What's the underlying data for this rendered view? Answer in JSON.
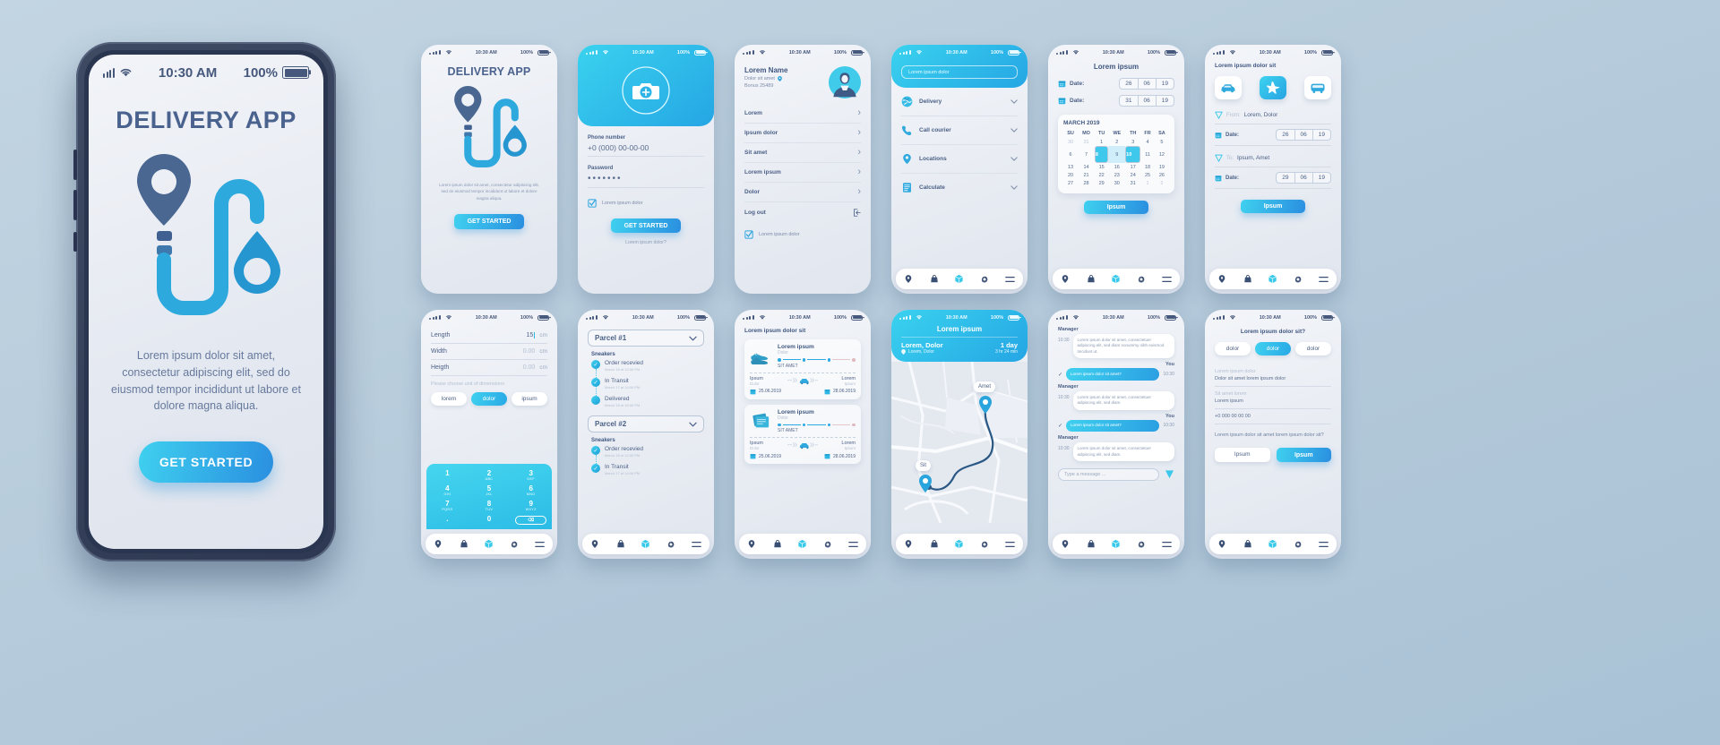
{
  "meta": {
    "status_time": "10:30 AM",
    "battery": "100%",
    "accent_cyan": "#3fd0ef",
    "accent_blue": "#2a8fe0",
    "navy": "#4a628e"
  },
  "main_phone": {
    "title": "DELIVERY APP",
    "description": "Lorem ipsum dolor sit amet, consectetur adipiscing elit, sed do eiusmod tempor incididunt ut labore et dolore magna aliqua.",
    "cta": "GET STARTED"
  },
  "screens": {
    "splash": {
      "title": "DELIVERY APP",
      "description": "Lorem ipsum dolor sit amet, consectetur adipiscing elit, sed do eiusmod tempor incididunt ut labore et dolore magna aliqua.",
      "cta": "GET STARTED"
    },
    "login": {
      "phone_label": "Phone number",
      "phone_value": "+0 (000) 00-00-00",
      "password_label": "Password",
      "password_value": "•••••••",
      "checkbox_label": "Lorem ipsum dolor",
      "cta": "GET STARTED",
      "footer_link": "Lorem ipsum dolor?"
    },
    "profile": {
      "name": "Lorem Name",
      "location": "Dolor sit amet",
      "bonus": "Bonus 25489",
      "items": [
        "Lorem",
        "Ipsum dolor",
        "Sit amet",
        "Lorem ipsum",
        "Dolor"
      ],
      "logout": "Log out",
      "checkbox_label": "Lorem ipsum dolor"
    },
    "menu": {
      "search_placeholder": "Lorem ipsum dolor",
      "items": [
        {
          "label": "Delivery",
          "icon": "globe-icon"
        },
        {
          "label": "Call courier",
          "icon": "phone-icon"
        },
        {
          "label": "Locations",
          "icon": "pin-icon"
        },
        {
          "label": "Calculate",
          "icon": "document-icon"
        }
      ]
    },
    "calendar": {
      "title": "Lorem ipsum",
      "date_label": "Date:",
      "date_from": [
        "26",
        "06",
        "19"
      ],
      "date_to": [
        "31",
        "06",
        "19"
      ],
      "month": "MARCH 2019",
      "weekdays": [
        "SU",
        "MO",
        "TU",
        "WE",
        "TH",
        "FR",
        "SA"
      ],
      "weeks": [
        [
          {
            "d": "30",
            "t": "out"
          },
          {
            "d": "31",
            "t": "out"
          },
          {
            "d": "1"
          },
          {
            "d": "2"
          },
          {
            "d": "3"
          },
          {
            "d": "4"
          },
          {
            "d": "5"
          }
        ],
        [
          {
            "d": "6"
          },
          {
            "d": "7"
          },
          {
            "d": "8",
            "t": "sel"
          },
          {
            "d": "9",
            "t": "rng"
          },
          {
            "d": "10",
            "t": "sel"
          },
          {
            "d": "11"
          },
          {
            "d": "12"
          }
        ],
        [
          {
            "d": "13"
          },
          {
            "d": "14"
          },
          {
            "d": "15"
          },
          {
            "d": "16"
          },
          {
            "d": "17"
          },
          {
            "d": "18"
          },
          {
            "d": "19"
          }
        ],
        [
          {
            "d": "20"
          },
          {
            "d": "21"
          },
          {
            "d": "22"
          },
          {
            "d": "23"
          },
          {
            "d": "24"
          },
          {
            "d": "25"
          },
          {
            "d": "26"
          }
        ],
        [
          {
            "d": "27"
          },
          {
            "d": "28"
          },
          {
            "d": "29"
          },
          {
            "d": "30"
          },
          {
            "d": "31"
          },
          {
            "d": "1",
            "t": "out"
          },
          {
            "d": "2",
            "t": "out"
          }
        ]
      ],
      "cta": "Ipsum"
    },
    "transport": {
      "title": "Lorem ipsum dolor sit",
      "modes": [
        {
          "name": "car-icon",
          "active": false
        },
        {
          "name": "plane-icon",
          "active": true
        },
        {
          "name": "bus-icon",
          "active": false
        }
      ],
      "from_label": "From:",
      "from_value": "Lorem, Dolor",
      "from_date_label": "Date:",
      "from_date": [
        "26",
        "06",
        "19"
      ],
      "to_label": "To:",
      "to_value": "Ipsum, Amet",
      "to_date_label": "Date:",
      "to_date": [
        "29",
        "06",
        "19"
      ],
      "cta": "Ipsum"
    },
    "dimensions": {
      "fields": [
        {
          "label": "Length",
          "value": "15",
          "unit": "cm",
          "active": true
        },
        {
          "label": "Width",
          "value": "0.00",
          "unit": "cm",
          "active": false
        },
        {
          "label": "Heigth",
          "value": "0.00",
          "unit": "cm",
          "active": false
        }
      ],
      "hint": "Please choose unit of dimensions",
      "units": [
        {
          "label": "lorem",
          "active": false
        },
        {
          "label": "dolor",
          "active": true
        },
        {
          "label": "ipsum",
          "active": false
        }
      ],
      "keypad": [
        {
          "n": "1",
          "s": ""
        },
        {
          "n": "2",
          "s": "ABC"
        },
        {
          "n": "3",
          "s": "DEF"
        },
        {
          "n": "4",
          "s": "GHI"
        },
        {
          "n": "5",
          "s": "JKL"
        },
        {
          "n": "6",
          "s": "MNO"
        },
        {
          "n": "7",
          "s": "PQRS"
        },
        {
          "n": "8",
          "s": "TUV"
        },
        {
          "n": "9",
          "s": "WXYZ"
        },
        {
          "n": ".",
          "s": ""
        },
        {
          "n": "0",
          "s": ""
        },
        {
          "n": "⌫",
          "s": ""
        }
      ]
    },
    "tracking": {
      "parcels": [
        {
          "title": "Parcel #1",
          "item": "Sneakers",
          "steps": [
            {
              "label": "Order recevied",
              "time": "March 16 at 12:06 PM",
              "done": true
            },
            {
              "label": "In Transit",
              "time": "March 17 at 14:06 PM",
              "done": true
            },
            {
              "label": "Delivered",
              "time": "March 18 at 15:06 PM",
              "done": false
            }
          ]
        },
        {
          "title": "Parcel #2",
          "item": "Sneakers",
          "steps": [
            {
              "label": "Order recevied",
              "time": "March 16 at 12:06 PM",
              "done": true
            },
            {
              "label": "In Transit",
              "time": "March 17 at 14:06 PM",
              "done": true
            }
          ]
        }
      ]
    },
    "orders": {
      "title": "Lorem ipsum dolor sit",
      "cards": [
        {
          "icon": "sneaker-icon",
          "title": "Lorem ipsum",
          "subtitle": "Dolor",
          "code": "SIT AMET",
          "from_label": "Ipsum",
          "from_sub": "Dolor",
          "to_label": "Lorem",
          "to_sub": "Ipsum",
          "date_from": "25.06.2019",
          "date_to": "28.06.2019",
          "transport": "car-icon"
        },
        {
          "icon": "book-icon",
          "title": "Lorem ipsum",
          "subtitle": "Dolor",
          "code": "SIT AMET",
          "from_label": "Ipsum",
          "from_sub": "Dolor",
          "to_label": "Lorem",
          "to_sub": "Ipsum",
          "date_from": "25.06.2019",
          "date_to": "28.06.2019",
          "transport": "car-icon"
        }
      ]
    },
    "map": {
      "title": "Lorem ipsum",
      "route_from": "Lorem, Dolor",
      "route_sub": "Lorem, Dolor",
      "duration": "1 day",
      "duration_sub": "3 hr  24 min",
      "marker_a": "Amet",
      "marker_b": "Sit"
    },
    "chat": {
      "messages": [
        {
          "who": "Manager",
          "time": "10:30",
          "text": "Lorem ipsum dolor sit amet, consectetuer adipiscing elit, sed diam nonummy nibh euismod tincidunt ut.",
          "side": "them"
        },
        {
          "who": "You",
          "time": "10:30",
          "text": "Lorem ipsum dolor sit amet?",
          "side": "me"
        },
        {
          "who": "Manager",
          "time": "10:30",
          "text": "Lorem ipsum dolor sit amet, consectetuer adipiscing elit, sed diam.",
          "side": "them"
        },
        {
          "who": "You",
          "time": "10:30",
          "text": "Lorem ipsum dolor sit amet?",
          "side": "me"
        },
        {
          "who": "Manager",
          "time": "10:30",
          "text": "Lorem ipsum dolor sit amet, consectetuer adipiscing elit, sed diam.",
          "side": "them"
        }
      ],
      "input_placeholder": "Type a message ..."
    },
    "details": {
      "title": "Lorem ipsum dolor sit?",
      "tabs": [
        {
          "label": "dolor",
          "active": false
        },
        {
          "label": "dolor",
          "active": true
        },
        {
          "label": "dolor",
          "active": false
        }
      ],
      "group1_label": "Lorem ipsum dolor",
      "group1_value": "Dolor sit amet lorem ipsum dolor",
      "group2_label": "Sit amet lorem",
      "group2_value": "Lorem ipsum",
      "group3_value": "+0 000 00 00 00",
      "note": "Lorem ipsum dolor sit amet lorem ipsum dolor sit?",
      "buttons": [
        {
          "label": "Ipsum",
          "primary": false
        },
        {
          "label": "Ipsum",
          "primary": true
        }
      ]
    }
  },
  "tabbar": {
    "items": [
      "pin-icon",
      "bag-icon",
      "box-icon",
      "gear-icon",
      "menu-icon"
    ],
    "active_index": 2
  }
}
